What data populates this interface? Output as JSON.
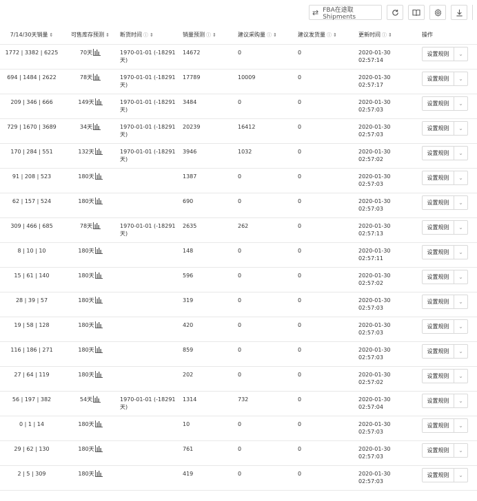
{
  "toolbar": {
    "fba_label": "FBA在途取Shipments"
  },
  "columns": {
    "sales": "7/14/30天销量",
    "stock": "可售库存预测",
    "stockout": "断货时间",
    "forecast": "销量预测",
    "purchase": "建议采购量",
    "ship": "建议发货量",
    "updated": "更新时间",
    "action": "操作"
  },
  "rule_label": "设置规则",
  "rows": [
    {
      "sales": "1772 | 3382 | 6225",
      "stock": "70天",
      "stockout": "1970-01-01 (-18291 天)",
      "forecast": "14672",
      "purchase": "0",
      "ship": "0",
      "updated": "2020-01-30 02:57:14"
    },
    {
      "sales": "694 | 1484 | 2622",
      "stock": "78天",
      "stockout": "1970-01-01 (-18291 天)",
      "forecast": "17789",
      "purchase": "10009",
      "ship": "0",
      "updated": "2020-01-30 02:57:17"
    },
    {
      "sales": "209 | 346 | 666",
      "stock": "149天",
      "stockout": "1970-01-01 (-18291 天)",
      "forecast": "3484",
      "purchase": "0",
      "ship": "0",
      "updated": "2020-01-30 02:57:03"
    },
    {
      "sales": "729 | 1670 | 3689",
      "stock": "34天",
      "stockout": "1970-01-01 (-18291 天)",
      "forecast": "20239",
      "purchase": "16412",
      "ship": "0",
      "updated": "2020-01-30 02:57:03"
    },
    {
      "sales": "170 | 284 | 551",
      "stock": "132天",
      "stockout": "1970-01-01 (-18291 天)",
      "forecast": "3946",
      "purchase": "1032",
      "ship": "0",
      "updated": "2020-01-30 02:57:02"
    },
    {
      "sales": "91 | 208 | 523",
      "stock": "180天",
      "stockout": "",
      "forecast": "1387",
      "purchase": "0",
      "ship": "0",
      "updated": "2020-01-30 02:57:03"
    },
    {
      "sales": "62 | 157 | 524",
      "stock": "180天",
      "stockout": "",
      "forecast": "690",
      "purchase": "0",
      "ship": "0",
      "updated": "2020-01-30 02:57:03"
    },
    {
      "sales": "309 | 466 | 685",
      "stock": "78天",
      "stockout": "1970-01-01 (-18291 天)",
      "forecast": "2635",
      "purchase": "262",
      "ship": "0",
      "updated": "2020-01-30 02:57:13"
    },
    {
      "sales": "8 | 10 | 10",
      "stock": "180天",
      "stockout": "",
      "forecast": "148",
      "purchase": "0",
      "ship": "0",
      "updated": "2020-01-30 02:57:11"
    },
    {
      "sales": "15 | 61 | 140",
      "stock": "180天",
      "stockout": "",
      "forecast": "596",
      "purchase": "0",
      "ship": "0",
      "updated": "2020-01-30 02:57:02"
    },
    {
      "sales": "28 | 39 | 57",
      "stock": "180天",
      "stockout": "",
      "forecast": "319",
      "purchase": "0",
      "ship": "0",
      "updated": "2020-01-30 02:57:03"
    },
    {
      "sales": "19 | 58 | 128",
      "stock": "180天",
      "stockout": "",
      "forecast": "420",
      "purchase": "0",
      "ship": "0",
      "updated": "2020-01-30 02:57:03"
    },
    {
      "sales": "116 | 186 | 271",
      "stock": "180天",
      "stockout": "",
      "forecast": "859",
      "purchase": "0",
      "ship": "0",
      "updated": "2020-01-30 02:57:03"
    },
    {
      "sales": "27 | 64 | 119",
      "stock": "180天",
      "stockout": "",
      "forecast": "202",
      "purchase": "0",
      "ship": "0",
      "updated": "2020-01-30 02:57:02"
    },
    {
      "sales": "56 | 197 | 382",
      "stock": "54天",
      "stockout": "1970-01-01 (-18291 天)",
      "forecast": "1314",
      "purchase": "732",
      "ship": "0",
      "updated": "2020-01-30 02:57:04"
    },
    {
      "sales": "0 | 1 | 14",
      "stock": "180天",
      "stockout": "",
      "forecast": "10",
      "purchase": "0",
      "ship": "0",
      "updated": "2020-01-30 02:57:03"
    },
    {
      "sales": "29 | 62 | 130",
      "stock": "180天",
      "stockout": "",
      "forecast": "761",
      "purchase": "0",
      "ship": "0",
      "updated": "2020-01-30 02:57:03"
    },
    {
      "sales": "2 | 5 | 309",
      "stock": "180天",
      "stockout": "",
      "forecast": "419",
      "purchase": "0",
      "ship": "0",
      "updated": "2020-01-30 02:57:03"
    }
  ]
}
